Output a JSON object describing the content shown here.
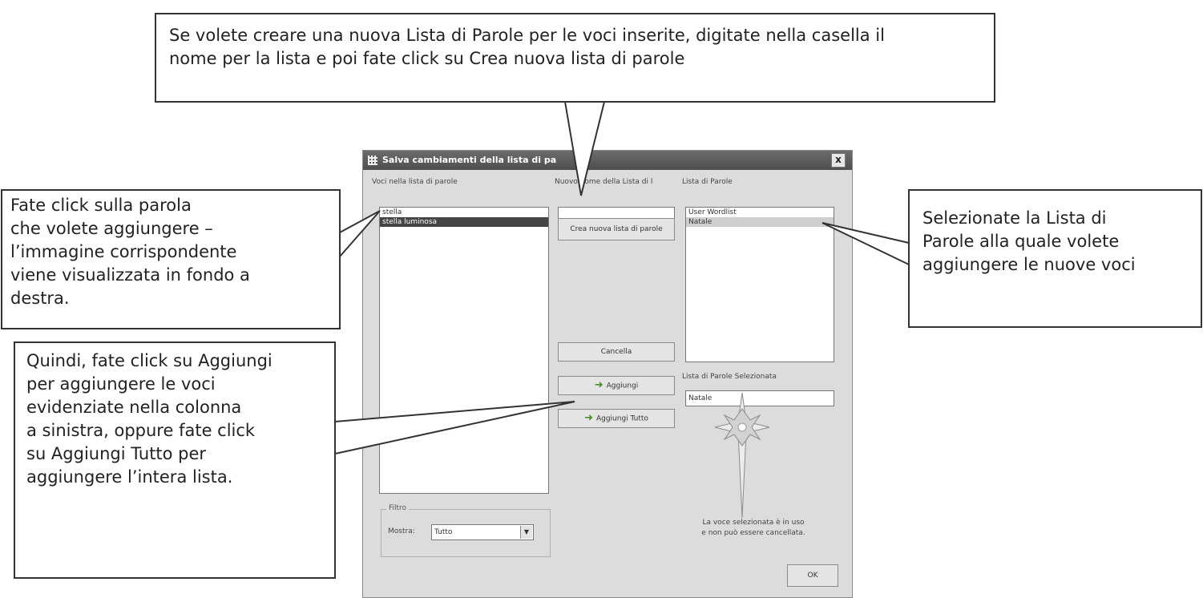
{
  "callouts": {
    "top": [
      "Se volete creare una nuova Lista di Parole per le voci inserite, digitate nella casella il",
      "nome per la lista e poi fate click su Crea nuova lista di parole"
    ],
    "left1": [
      "Fate click sulla parola",
      "che volete aggiungere –",
      "l’immagine corrispondente",
      "viene visualizzata in fondo a",
      "destra."
    ],
    "right": [
      "Selezionate la Lista di",
      "Parole alla quale volete",
      "aggiungere le nuove voci"
    ],
    "left2": [
      "Quindi, fate click su Aggiungi",
      "per aggiungere le voci",
      "evidenziate nella colonna",
      "a sinistra, oppure fate click",
      "su Aggiungi Tutto per",
      "aggiungere l’intera lista."
    ]
  },
  "dialog": {
    "title": "Salva cambiamenti della lista di pa",
    "close_label": "x",
    "left_column_label": "Voci nella lista di parole",
    "left_list": [
      {
        "text": "stella",
        "selected": false
      },
      {
        "text": "stella luminosa",
        "selected": true
      }
    ],
    "middle_column_label": "Nuovo nome della Lista di l",
    "new_name_value": "",
    "create_button_label": "Crea nuova lista di parole",
    "right_column_label": "Lista di Parole",
    "right_list": [
      {
        "text": "User Wordlist",
        "selected": false
      },
      {
        "text": "Natale",
        "selected": true
      }
    ],
    "cancel_button_label": "Cancella",
    "add_button_label": "Aggiungi",
    "add_all_button_label": "Aggiungi Tutto",
    "selected_list_label": "Lista di Parole Selezionata",
    "selected_list_value": "Natale",
    "filter_legend": "Filtro",
    "show_label": "Mostra:",
    "show_value": "Tutto",
    "note_line1": "La voce selezionata è in uso",
    "note_line2": "e non può essere cancellata.",
    "ok_button_label": "OK"
  },
  "icons": {
    "add_arrow": "right-arrow-icon",
    "preview": "star-icon",
    "dropdown": "chevron-down-icon",
    "close": "close-icon"
  },
  "colors": {
    "titlebar": "#555555",
    "dialog_bg": "#dcdcdc",
    "selection": "#454545",
    "arrow": "#4a8a2c"
  }
}
